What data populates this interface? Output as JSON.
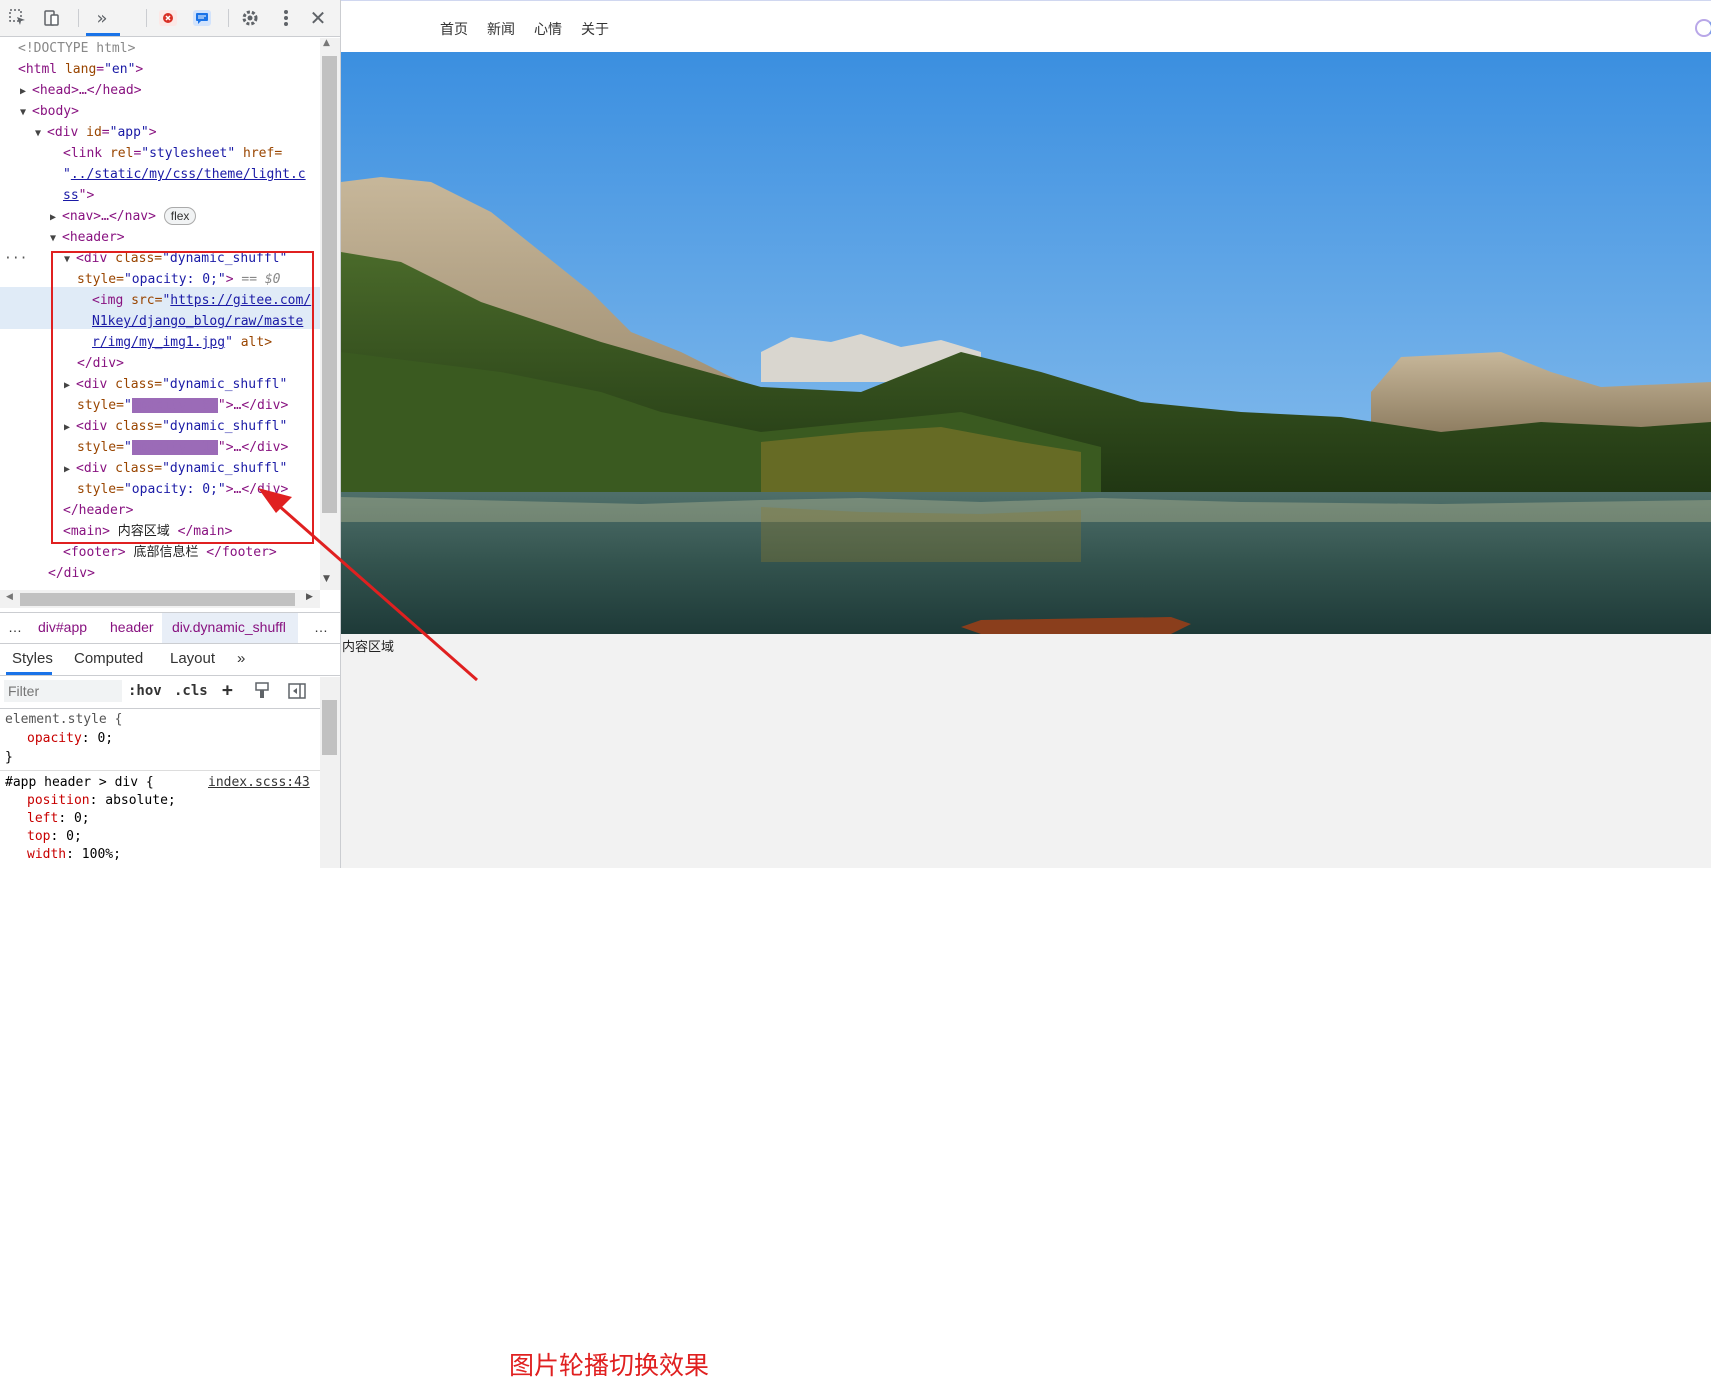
{
  "devtools": {
    "dom_lines": {
      "doctype": "<!DOCTYPE html>",
      "html_open": "<html",
      "html_attr": "lang",
      "html_val": "\"en\"",
      "head": "<head>…</head>",
      "body_open": "<body>",
      "div_app_open": "<div",
      "div_app_attr": "id",
      "div_app_val": "\"app\"",
      "link_open": "<link",
      "link_rel_attr": "rel",
      "link_rel_val": "\"stylesheet\"",
      "link_href_attr": "href=",
      "link_href_val1": "\"",
      "link_href_link1": "../static/my/css/theme/light.c",
      "link_href_link2": "ss",
      "link_close": "\">",
      "nav": "<nav>…</nav>",
      "nav_badge": "flex",
      "header_open": "<header>",
      "div1_open": "<div",
      "div1_attr": "class=",
      "div1_val": "\"dynamic_shuffl\"",
      "div1_style_attr": "style=",
      "div1_style_val": "\"opacity: 0;\"",
      "div1_tail": ">",
      "div1_eq": "== $0",
      "img_open": "<img",
      "img_src_attr": "src=",
      "img_src_link1": "https://gitee.com/",
      "img_src_link2": "N1key/django_blog/raw/maste",
      "img_src_link3": "r/img/my_img1.jpg",
      "img_alt": "alt>",
      "div1_close": "</div>",
      "div2_open": "<div",
      "div2_attr": "class=",
      "div2_val": "\"dynamic_shuffl\"",
      "div2_style_attr": "style=",
      "div2_style_val": "opacity: 0;",
      "div2_tail": "\">…</div>",
      "div3_open": "<div",
      "div3_attr": "class=",
      "div3_val": "\"dynamic_shuffl\"",
      "div3_style_attr": "style=",
      "div3_style_val": "opacity: 1;",
      "div3_tail": "\">…</div>",
      "div4_open": "<div",
      "div4_attr": "class=",
      "div4_val": "\"dynamic_shuffl\"",
      "div4_style_attr": "style=",
      "div4_style_val": "\"opacity: 0;\"",
      "div4_tail": ">…</div>",
      "header_close": "</header>",
      "main_open": "<main>",
      "main_text": "内容区域",
      "main_close": "</main>",
      "footer_open": "<footer>",
      "footer_text": "底部信息栏",
      "footer_close": "</footer>",
      "div_app_close": "</div>",
      "ellipsis": "···"
    },
    "breadcrumbs": {
      "more_left": "…",
      "div_app": "div#app",
      "header": "header",
      "div_dynamic": "div.dynamic_shuffl",
      "more_right": "…"
    },
    "tabs": {
      "styles": "Styles",
      "computed": "Computed",
      "layout": "Layout",
      "more": "»"
    },
    "filter": {
      "placeholder": "Filter",
      "hov": ":hov",
      "cls": ".cls",
      "add": "+"
    },
    "styles_pane": {
      "element_style": "element.style {",
      "opacity_prop": "opacity",
      "opacity_val": "0;",
      "close1": "}",
      "selector": "#app header > div {",
      "source": "index.scss:43",
      "position_prop": "position",
      "position_val": "absolute;",
      "left_prop": "left",
      "left_val": "0;",
      "top_prop": "top",
      "top_val": "0;",
      "width_prop": "width",
      "width_val": "100%;"
    }
  },
  "webpage": {
    "nav": [
      "首页",
      "新闻",
      "心情",
      "关于"
    ],
    "main_label": "内容区域",
    "annotation": "图片轮播切换效果"
  },
  "colors": {
    "tag": "#881280",
    "attr": "#994500",
    "value": "#1a1aa6",
    "highlight": "#e02020",
    "sky_top": "#3b8fe0",
    "sky_bottom": "#9ccaf0"
  },
  "icons": [
    "inspect-icon",
    "device-toggle-icon",
    "more-panels-icon",
    "error-badge-icon",
    "message-badge-icon",
    "settings-gear-icon",
    "kebab-menu-icon",
    "close-icon",
    "loading-spinner-icon"
  ]
}
